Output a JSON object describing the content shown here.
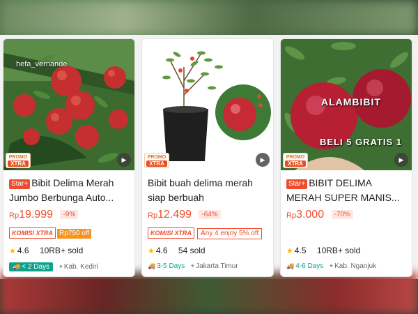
{
  "products": [
    {
      "watermark": "hefa_vernande",
      "promo_top": "PROMO",
      "promo_bottom": "XTRA",
      "badge": "Star+",
      "title": "Bibit Delima Merah Jumbo Berbunga Auto...",
      "currency": "Rp",
      "price": "19.999",
      "discount": "-9%",
      "komisi_label": "KOMISI XTRA",
      "komisi_amount": "Rp750 off",
      "rating": "4.6",
      "sold": "10RB+ sold",
      "shipping": "< 2 Days",
      "location": "Kab. Kediri"
    },
    {
      "promo_top": "PROMO",
      "promo_bottom": "XTRA",
      "title": "Bibit buah delima merah siap berbuah",
      "currency": "Rp",
      "price": "12.499",
      "discount": "-64%",
      "komisi_label": "KOMISI XTRA",
      "offer": "Any 4 enjoy 5% off",
      "rating": "4.6",
      "sold": "54 sold",
      "shipping": "3-5 Days",
      "location": "Jakarta Timur"
    },
    {
      "overlay1": "ALAMBIBIT",
      "overlay2": "BELI 5 GRATIS 1",
      "promo_top": "PROMO",
      "promo_bottom": "XTRA",
      "badge": "Star+",
      "title": "BIBIT DELIMA MERAH SUPER MANIS...",
      "currency": "Rp",
      "price": "3.000",
      "discount": "-70%",
      "rating": "4.5",
      "sold": "10RB+ sold",
      "shipping": "4-6 Days",
      "location": "Kab. Nganjuk"
    }
  ],
  "icons": {
    "star": "star-icon",
    "truck": "truck-icon",
    "pin": "location-pin-icon",
    "play": "play-icon"
  },
  "colors": {
    "accent": "#ee4d2d",
    "shipping": "#0da38b",
    "rating_star": "#ffb300",
    "komisi_amount_bg": "#f7931e"
  }
}
